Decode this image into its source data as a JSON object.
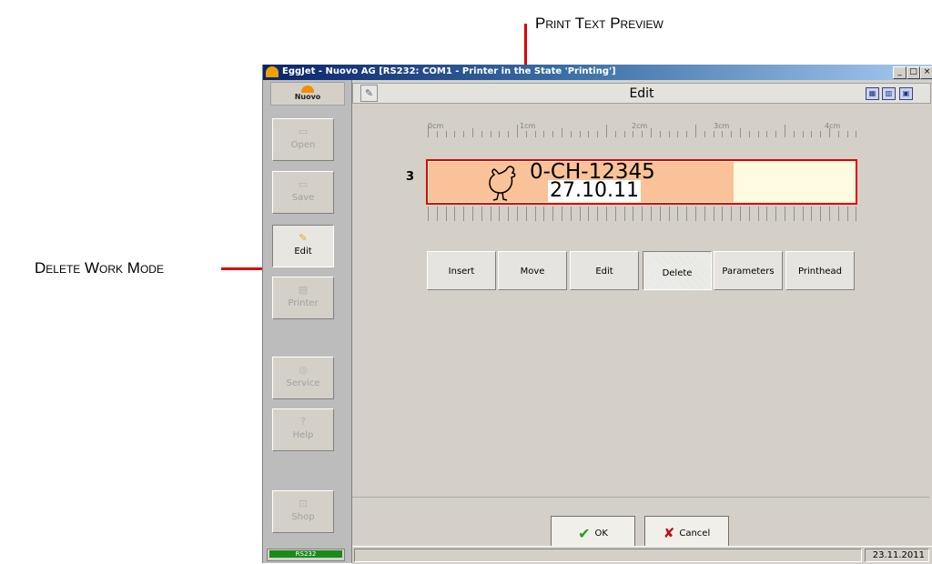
{
  "annotations": {
    "print_text_preview": "Print Text Preview",
    "delete_work_mode": "Delete Work Mode"
  },
  "window": {
    "title": "EggJet - Nuovo AG   [RS232: COM1 - Printer in the State 'Printing']",
    "controls": [
      "_",
      "□",
      "×"
    ]
  },
  "logo": "Nuovo",
  "sidebar": {
    "items": [
      {
        "label": "Open",
        "icon": "folder-icon"
      },
      {
        "label": "Save",
        "icon": "folder-icon"
      },
      {
        "label": "Edit",
        "icon": "edit-icon",
        "active": true
      },
      {
        "label": "Printer",
        "icon": "printer-icon"
      },
      {
        "label": "Service",
        "icon": "service-icon"
      },
      {
        "label": "Help",
        "icon": "help-icon"
      },
      {
        "label": "Shop",
        "icon": "shop-icon"
      }
    ]
  },
  "header": {
    "title": "Edit"
  },
  "ruler": {
    "labels": [
      "0cm",
      "1cm",
      "2cm",
      "3cm",
      "4cm"
    ]
  },
  "preview": {
    "row_number": "3",
    "line1": "0-CH-12345",
    "line2": "27.10.11"
  },
  "modes": [
    {
      "label": "Insert"
    },
    {
      "label": "Move"
    },
    {
      "label": "Edit"
    },
    {
      "label": "Delete",
      "active": true
    },
    {
      "label": "Parameters"
    },
    {
      "label": "Printhead"
    }
  ],
  "actions": {
    "ok": "OK",
    "cancel": "Cancel"
  },
  "status": {
    "connection": "RS232",
    "date": "23.11.2011"
  },
  "colors": {
    "highlight": "#e00000",
    "preview_fill": "#f9c298",
    "ok_check": "#2a9a20",
    "cancel_x": "#c01010"
  }
}
